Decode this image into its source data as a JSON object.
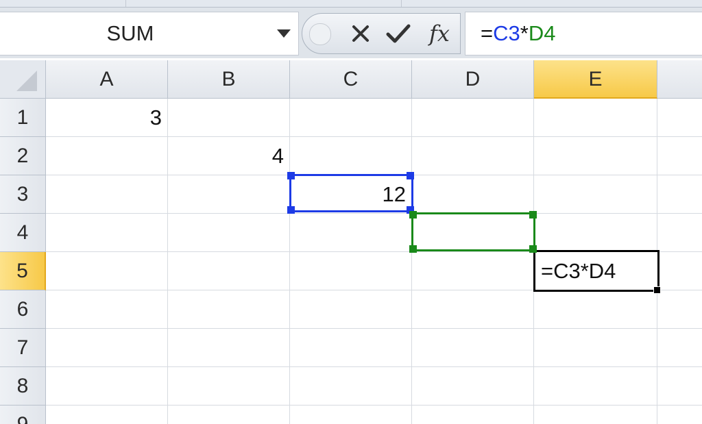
{
  "name_box": {
    "value": "SUM"
  },
  "formula_bar": {
    "formula_prefix": "=",
    "ref1": "C3",
    "operator": "*",
    "ref2": "D4"
  },
  "columns": [
    "A",
    "B",
    "C",
    "D",
    "E"
  ],
  "rows": [
    "1",
    "2",
    "3",
    "4",
    "5",
    "6",
    "7",
    "8",
    "9"
  ],
  "active_cell": {
    "column": "E",
    "row": "5"
  },
  "cells": {
    "A1": "3",
    "B2": "4",
    "C3": "12",
    "E5": "=C3*D4"
  },
  "colors": {
    "ref1_highlight": "#1d3be6",
    "ref2_highlight": "#1a8a1a",
    "active_header": "#f7c948"
  },
  "icons": {
    "name_box_dropdown": "chevron-down-icon",
    "cancel": "close-icon",
    "enter": "checkmark-icon",
    "insert_function": "fx-icon",
    "select_all": "select-all-triangle-icon"
  }
}
